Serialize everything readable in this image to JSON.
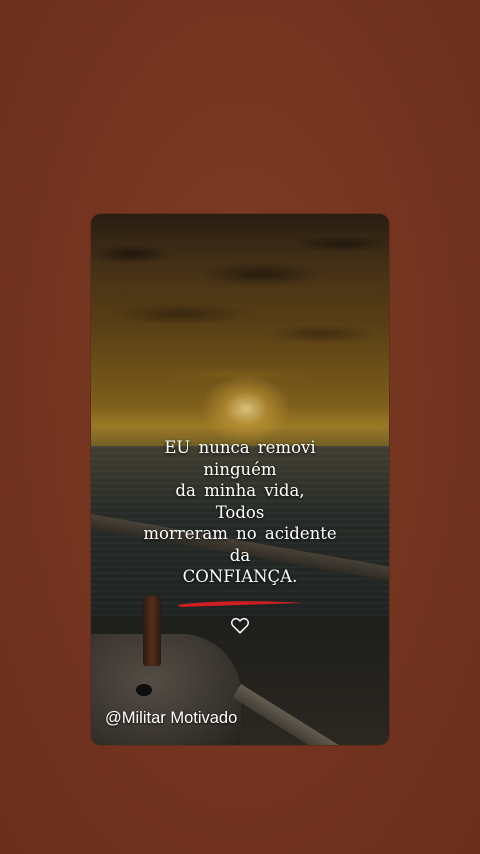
{
  "post": {
    "quote_lines": [
      "EU nunca removi",
      "ninguém",
      "da minha vida,",
      "Todos",
      "morreram no acidente",
      "da",
      "CONFIANÇA."
    ],
    "author_handle": "@Militar Motivado",
    "accent_color": "#d01f24",
    "icons": [
      "heart-outline-icon",
      "red-brush-underline"
    ]
  }
}
